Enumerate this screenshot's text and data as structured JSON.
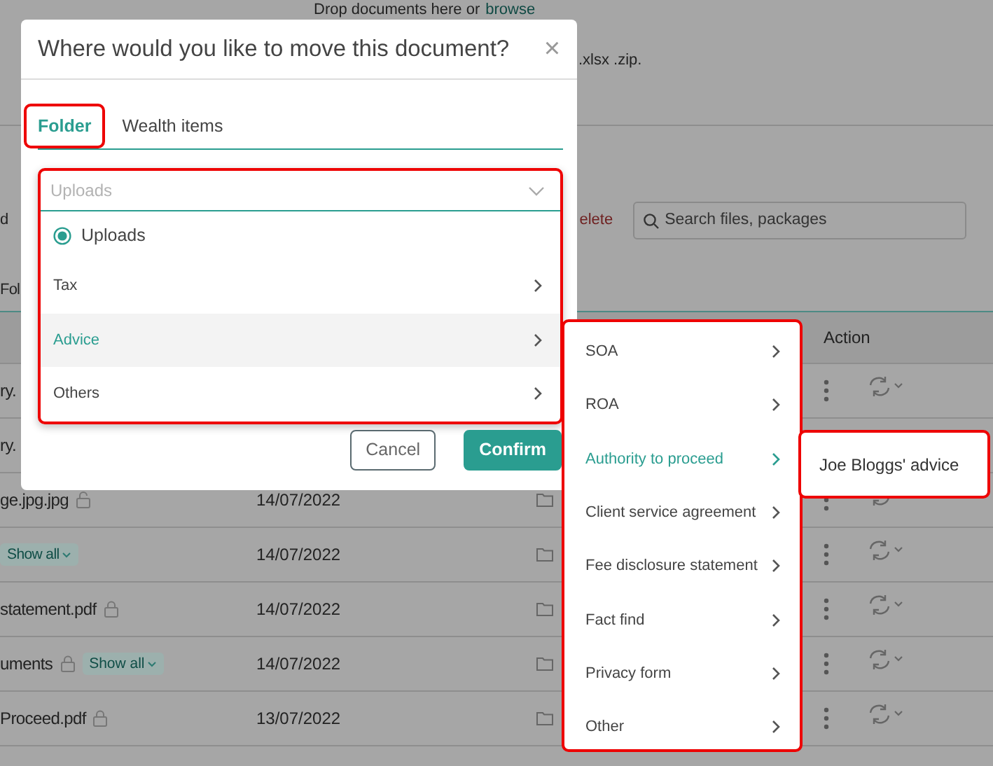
{
  "page": {
    "drop_text": "Drop documents here or",
    "browse_link": "browse",
    "formats": ".xlsx .zip.",
    "toolbar_fragment": "d",
    "delete_fragment": "elete",
    "search": {
      "placeholder": "Search files, packages"
    },
    "tab_fragment": "Fol",
    "action_header": "Action",
    "rows": [
      {
        "name": "ry.",
        "actions": true
      },
      {
        "name": "ry."
      },
      {
        "name": "ge.jpg.jpg",
        "locked": false,
        "date": "14/07/2022",
        "folder": true,
        "actions": true
      },
      {
        "chip": "Show all",
        "date": "14/07/2022",
        "folder": true,
        "actions": true
      },
      {
        "name": "statement.pdf",
        "locked": true,
        "date": "14/07/2022",
        "folder": true,
        "actions": true
      },
      {
        "name": "uments",
        "locked": true,
        "chip": "Show all",
        "date": "14/07/2022",
        "folder": true,
        "actions": true
      },
      {
        "name": "Proceed.pdf",
        "locked": true,
        "date": "13/07/2022",
        "folder": true,
        "actions": true
      }
    ]
  },
  "dialog": {
    "title": "Where would you like to move this document?",
    "close": "×",
    "tabs": [
      {
        "label": "Folder",
        "selected": true
      },
      {
        "label": "Wealth items",
        "selected": false
      }
    ],
    "select": {
      "placeholder": "Uploads"
    },
    "options": [
      {
        "label": "Uploads",
        "kind": "radio",
        "checked": true,
        "active": false
      },
      {
        "label": "Tax",
        "kind": "folder",
        "active": false
      },
      {
        "label": "Advice",
        "kind": "folder",
        "active": true
      },
      {
        "label": "Others",
        "kind": "folder",
        "active": false
      }
    ],
    "buttons": [
      {
        "label": "Cancel",
        "kind": "secondary"
      },
      {
        "label": "Confirm",
        "kind": "primary"
      }
    ]
  },
  "submenu": {
    "items": [
      {
        "label": "SOA",
        "active": false
      },
      {
        "label": "ROA",
        "active": false
      },
      {
        "label": "Authority to proceed",
        "active": true
      },
      {
        "label": "Client service agreement",
        "active": false
      },
      {
        "label": "Fee disclosure statement",
        "active": false
      },
      {
        "label": "Fact find",
        "active": false
      },
      {
        "label": "Privacy form",
        "active": false
      },
      {
        "label": "Other",
        "active": false
      }
    ]
  },
  "third_menu": {
    "items": [
      {
        "label": "Joe Bloggs' advice"
      }
    ]
  }
}
